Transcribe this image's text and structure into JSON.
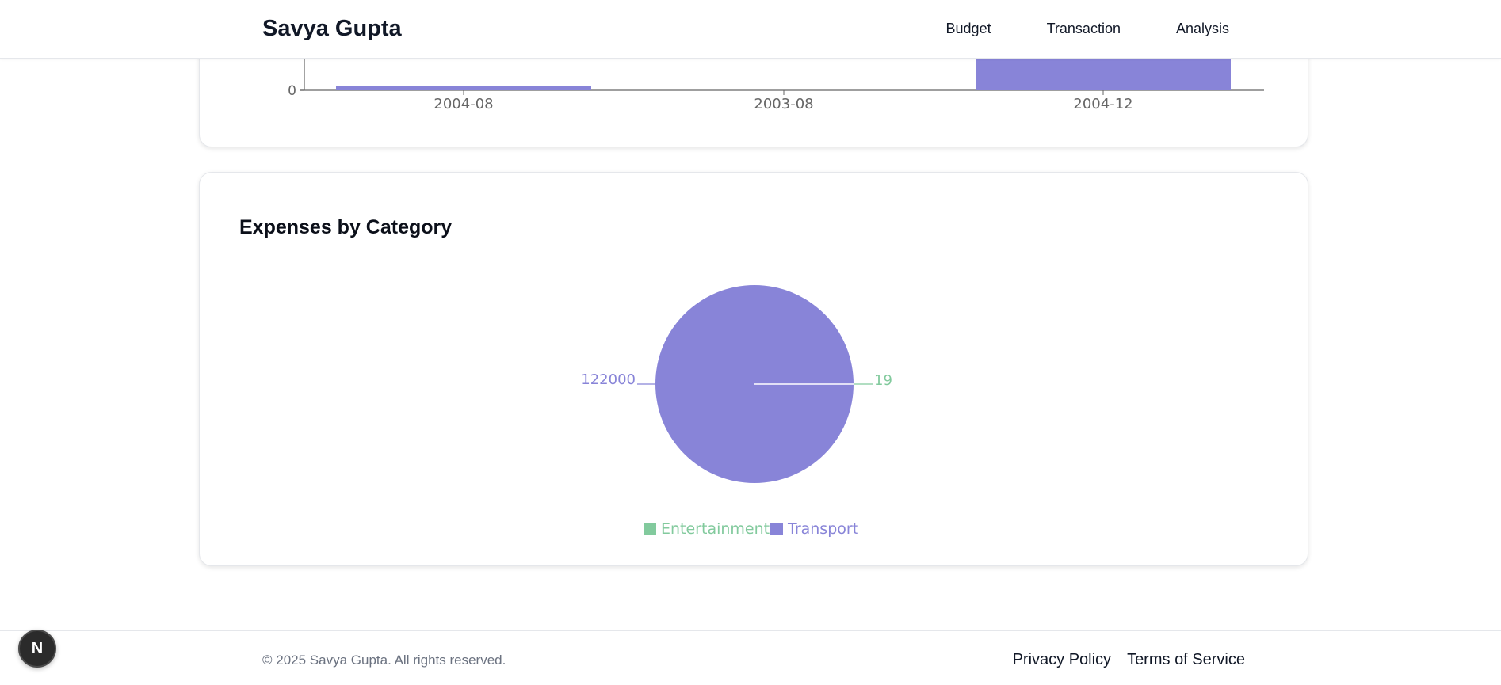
{
  "header": {
    "brand": "Savya Gupta",
    "nav": [
      {
        "label": "Budget"
      },
      {
        "label": "Transaction"
      },
      {
        "label": "Analysis"
      }
    ]
  },
  "bar_chart": {
    "y_tick_zero": "0"
  },
  "pie_section": {
    "title": "Expenses by Category"
  },
  "chart_data": [
    {
      "type": "bar",
      "categories": [
        "2004-08",
        "2003-08",
        "2004-12"
      ],
      "values": [
        null,
        0,
        null
      ],
      "color": "#8884d8",
      "note_visible_range": "partially scrolled; only baseline 0 tick visible"
    },
    {
      "type": "pie",
      "slices": [
        {
          "name": "Entertainment",
          "value": 19,
          "color": "#82ca9d"
        },
        {
          "name": "Transport",
          "value": 122000,
          "color": "#8884d8"
        }
      ],
      "legend": [
        "Entertainment",
        "Transport"
      ],
      "legend_placement": "bottom"
    }
  ],
  "footer": {
    "copyright": "© 2025 Savya Gupta. All rights reserved.",
    "links": [
      {
        "label": "Privacy Policy"
      },
      {
        "label": "Terms of Service"
      }
    ]
  },
  "badge": {
    "label": "N"
  }
}
